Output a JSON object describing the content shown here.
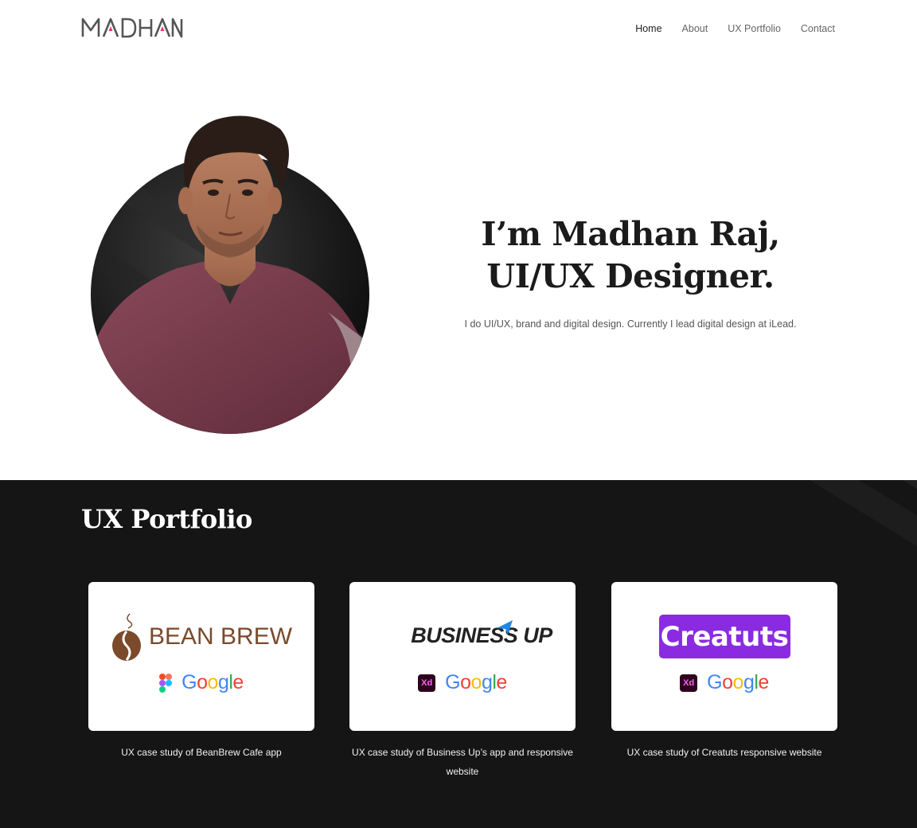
{
  "header": {
    "logo_text": "MADHAN",
    "nav": [
      {
        "label": "Home",
        "active": true
      },
      {
        "label": "About",
        "active": false
      },
      {
        "label": "UX Portfolio",
        "active": false
      },
      {
        "label": "Contact",
        "active": false
      }
    ]
  },
  "hero": {
    "title_line1": "I’m Madhan Raj,",
    "title_line2": "UI/UX Designer.",
    "subtitle": "I do UI/UX, brand and digital design. Currently I lead digital design at iLead."
  },
  "portfolio": {
    "title": "UX Portfolio",
    "cards": [
      {
        "brand": "BEAN BREW",
        "tool_icon": "figma-icon",
        "google_text": "Google",
        "caption": "UX case study of BeanBrew Cafe app"
      },
      {
        "brand": "BUSINESS UP",
        "tool_icon": "xd-icon",
        "tool_label": "Xd",
        "google_text": "Google",
        "caption": "UX case study of Business Up’s app and responsive website"
      },
      {
        "brand": "Creatuts",
        "tool_icon": "xd-icon",
        "tool_label": "Xd",
        "google_text": "Google",
        "caption": "UX case study of Creatuts responsive website"
      }
    ]
  },
  "colors": {
    "dark_section": "#151515",
    "logo_accent": "#e8336f",
    "creatuts_purple": "#8a2be2",
    "beanbrew_brown": "#7a4a2a"
  }
}
